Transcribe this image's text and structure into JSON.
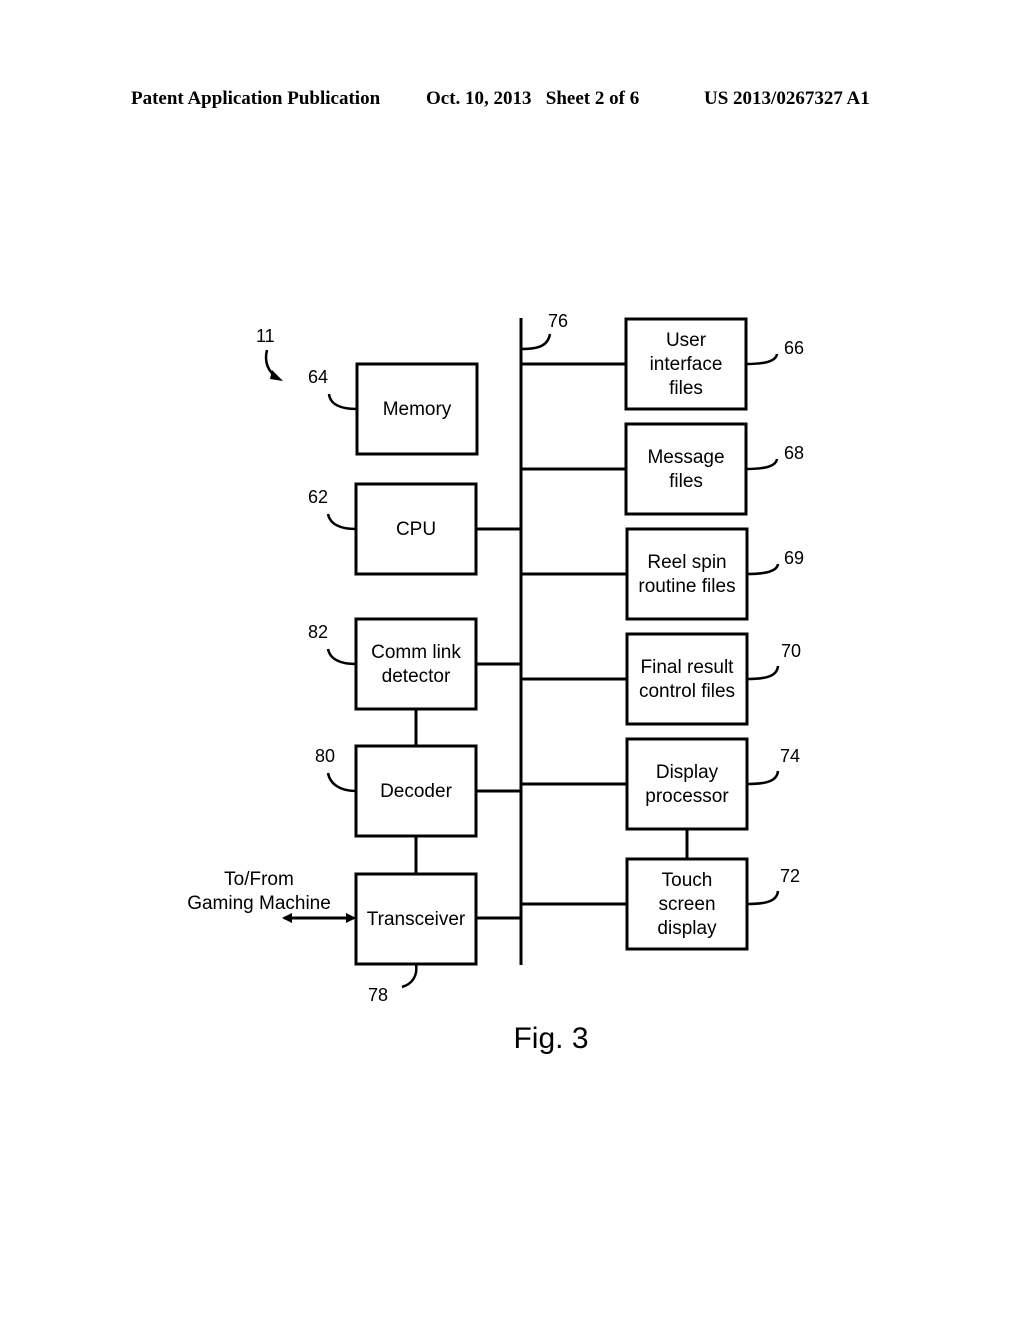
{
  "header": {
    "publication": "Patent Application Publication",
    "date_sheet": "Oct. 10, 2013   Sheet 2 of 6",
    "number": "US 2013/0267327 A1"
  },
  "figure": {
    "caption": "Fig. 3",
    "system_ref": "11",
    "bus_ref": "76",
    "external_link_label_line1": "To/From",
    "external_link_label_line2": "Gaming Machine"
  },
  "blocks": {
    "memory": {
      "lines": [
        "Memory"
      ],
      "ref": "64"
    },
    "cpu": {
      "lines": [
        "CPU"
      ],
      "ref": "62"
    },
    "comm_link_detector": {
      "lines": [
        "Comm link",
        "detector"
      ],
      "ref": "82"
    },
    "decoder": {
      "lines": [
        "Decoder"
      ],
      "ref": "80"
    },
    "transceiver": {
      "lines": [
        "Transceiver"
      ],
      "ref": "78"
    },
    "user_interface_files": {
      "lines": [
        "User",
        "interface",
        "files"
      ],
      "ref": "66"
    },
    "message_files": {
      "lines": [
        "Message",
        "files"
      ],
      "ref": "68"
    },
    "reel_spin_routine_files": {
      "lines": [
        "Reel spin",
        "routine files"
      ],
      "ref": "69"
    },
    "final_result_control_files": {
      "lines": [
        "Final result",
        "control files"
      ],
      "ref": "70"
    },
    "display_processor": {
      "lines": [
        "Display",
        "processor"
      ],
      "ref": "74"
    },
    "touch_screen_display": {
      "lines": [
        "Touch",
        "screen",
        "display"
      ],
      "ref": "72"
    }
  }
}
